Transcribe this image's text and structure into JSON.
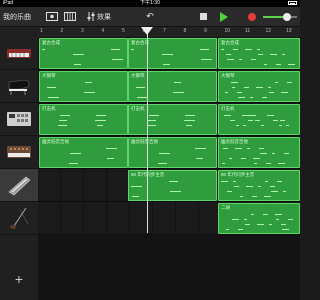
{
  "status": {
    "device": "iPad",
    "time": "下午1:30"
  },
  "toolbar": {
    "my_songs": "我的乐曲",
    "mixer_label": "效果",
    "volume_fraction": 0.7
  },
  "ruler": {
    "bars": [
      "1",
      "2",
      "3",
      "4",
      "5",
      "6",
      "7",
      "8",
      "9",
      "10",
      "11",
      "12",
      "13"
    ]
  },
  "tracks": [
    {
      "name": "keyboard-synth",
      "regions": [
        "复古合成",
        "复古合成",
        "复古合成"
      ]
    },
    {
      "name": "grand-piano",
      "regions": [
        "大钢琴",
        "大钢琴",
        "大钢琴"
      ]
    },
    {
      "name": "drum-machine",
      "regions": [
        "打击机",
        "打击机",
        "打击机"
      ]
    },
    {
      "name": "smart-strings",
      "regions": [
        "幽灵低音吉他",
        "幽灵低音吉他",
        "幽灵低音吉他"
      ]
    },
    {
      "name": "keytar",
      "regions": [
        "80 年代同步主音",
        "80 年代同步主音"
      ]
    },
    {
      "name": "guitar",
      "regions": [
        "二胡"
      ]
    }
  ],
  "colors": {
    "region": "#2f9d3d",
    "region_border": "#5dd768",
    "play": "#4fd23a",
    "record": "#e53b3b"
  }
}
